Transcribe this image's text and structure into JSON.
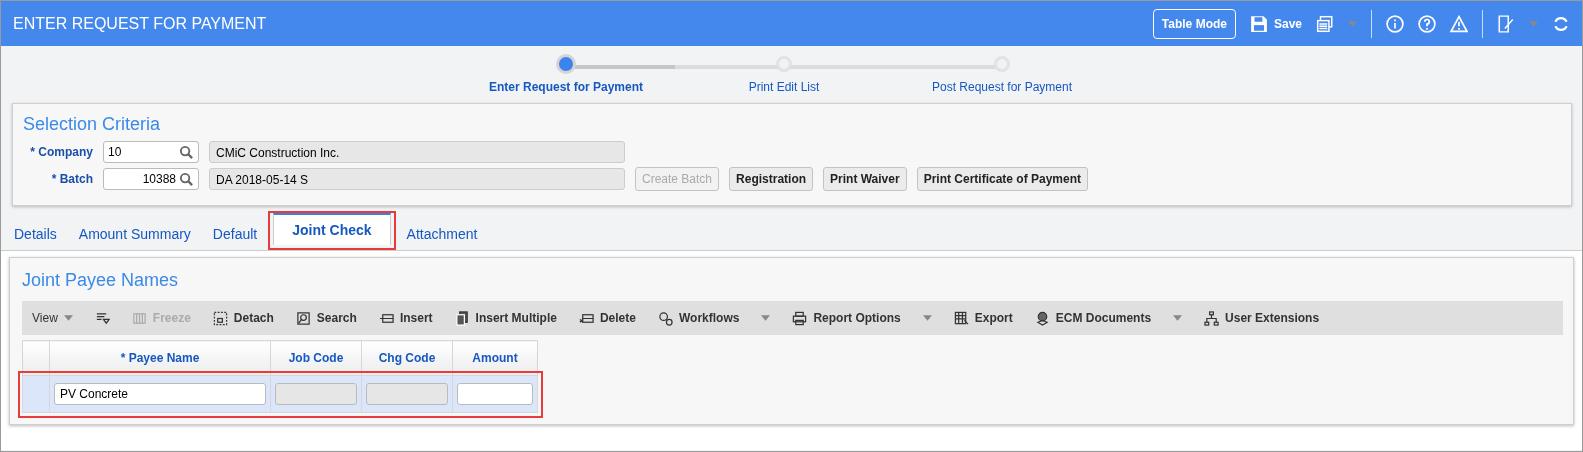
{
  "window": {
    "title": "ENTER REQUEST FOR PAYMENT"
  },
  "header_actions": [
    {
      "kind": "outline",
      "label": "Table Mode"
    },
    {
      "kind": "save",
      "label": "Save"
    }
  ],
  "steps": [
    {
      "label": "Enter Request for Payment",
      "selected": true
    },
    {
      "label": "Print Edit List",
      "selected": false
    },
    {
      "label": "Post Request for Payment",
      "selected": false
    }
  ],
  "progress": {
    "level": 0.25
  },
  "selection_criteria": {
    "title": "Selection Criteria",
    "fields": [
      {
        "label": "* Company",
        "value": "10",
        "description": "CMiC Construction Inc."
      },
      {
        "label": "* Batch",
        "value": "10388",
        "description": "DA 2018-05-14 S"
      }
    ],
    "buttons": [
      {
        "label": "Create Batch",
        "disabled": true
      },
      {
        "label": "Registration",
        "disabled": false
      },
      {
        "label": "Print Waiver",
        "disabled": false
      },
      {
        "label": "Print Certificate of Payment",
        "disabled": false
      }
    ]
  },
  "tabs": [
    {
      "label": "Details",
      "selected": false,
      "highlighted": false
    },
    {
      "label": "Amount Summary",
      "selected": false,
      "highlighted": false
    },
    {
      "label": "Default",
      "selected": false,
      "highlighted": false
    },
    {
      "label": "Joint Check",
      "selected": true,
      "highlighted": true
    },
    {
      "label": "Attachment",
      "selected": false,
      "highlighted": false
    }
  ],
  "joint_payee_names": {
    "title": "Joint Payee Names",
    "toolbar": [
      {
        "kind": "menu",
        "label": "View",
        "disabled": false
      },
      {
        "kind": "icon"
      },
      {
        "kind": "button",
        "label": "Freeze",
        "disabled": true
      },
      {
        "kind": "button",
        "label": "Detach",
        "disabled": false
      },
      {
        "kind": "button",
        "label": "Search",
        "disabled": false
      },
      {
        "kind": "button",
        "label": "Insert",
        "disabled": false
      },
      {
        "kind": "button",
        "label": "Insert Multiple",
        "disabled": false
      },
      {
        "kind": "button",
        "label": "Delete",
        "disabled": false
      },
      {
        "kind": "dropdown",
        "label": "Workflows",
        "disabled": false
      },
      {
        "kind": "dropdown",
        "label": "Report Options",
        "disabled": false
      },
      {
        "kind": "button",
        "label": "Export",
        "disabled": false
      },
      {
        "kind": "dropdown",
        "label": "ECM Documents",
        "disabled": false
      },
      {
        "kind": "button",
        "label": "User Extensions",
        "disabled": false
      }
    ],
    "columns": [
      "* Payee Name",
      "Job Code",
      "Chg Code",
      "Amount"
    ],
    "rows": [
      {
        "selected": true,
        "highlighted": true,
        "cells": [
          {
            "value": "PV Concrete",
            "editable": true
          },
          {
            "editable": false
          },
          {
            "editable": false
          },
          {
            "editable": true
          }
        ]
      }
    ]
  }
}
